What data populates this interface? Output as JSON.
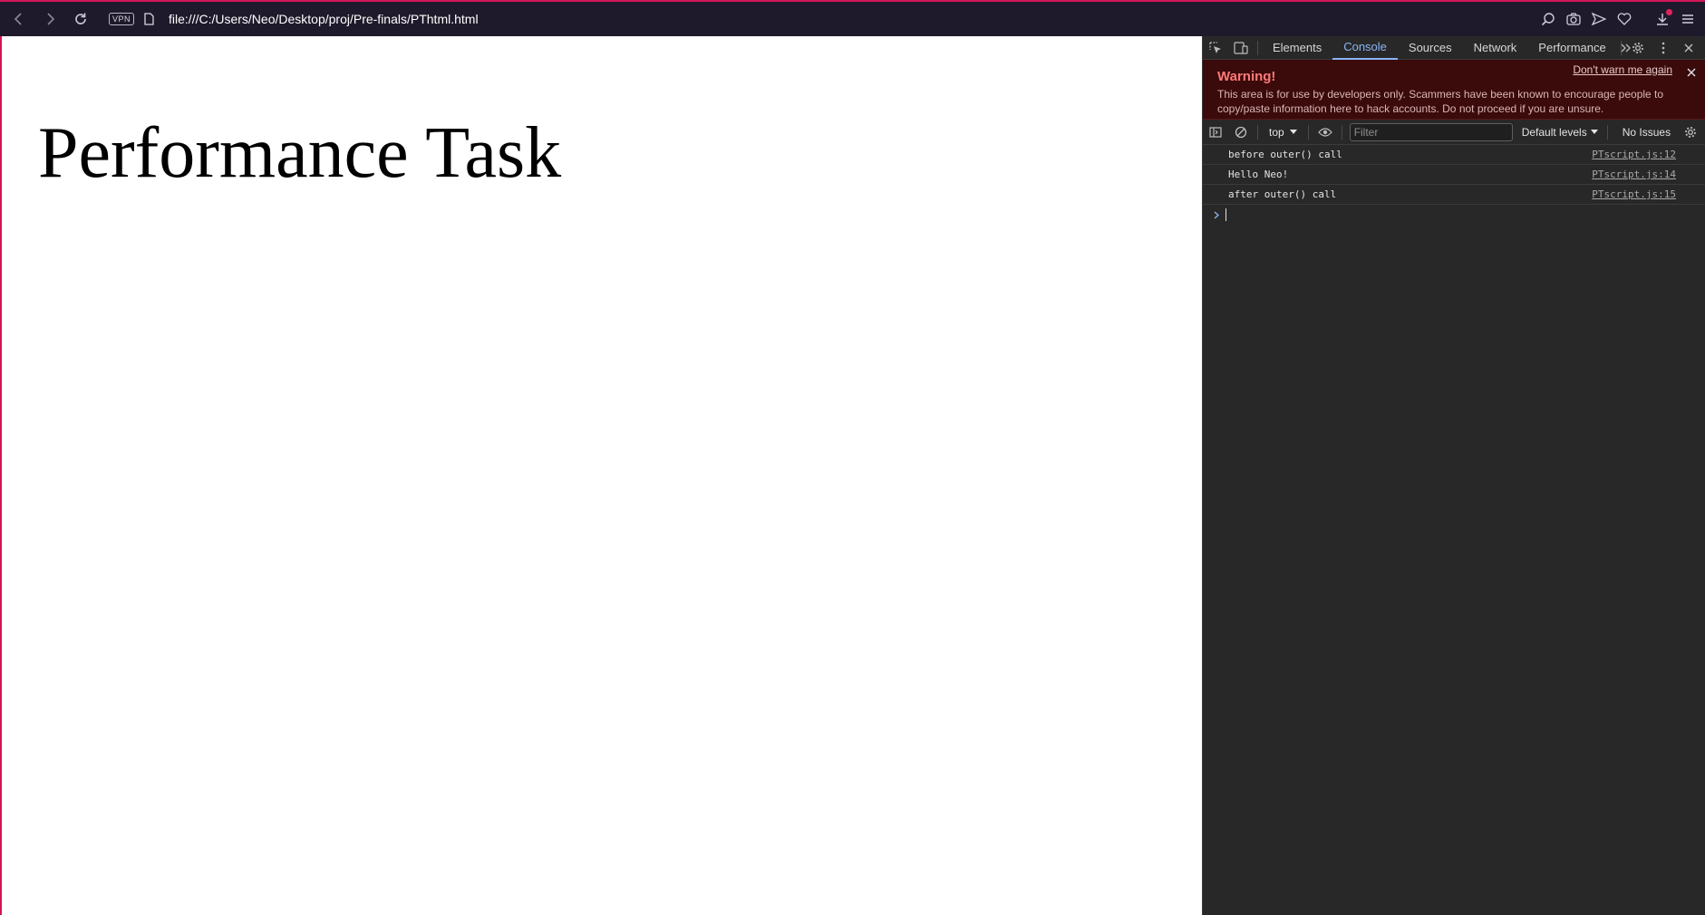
{
  "browser": {
    "address": "file:///C:/Users/Neo/Desktop/proj/Pre-finals/PThtml.html",
    "vpn_label": "VPN",
    "accent_color": "#d4145a"
  },
  "page": {
    "heading": "Performance Task"
  },
  "devtools": {
    "tabs": [
      "Elements",
      "Console",
      "Sources",
      "Network",
      "Performance"
    ],
    "active_tab": "Console",
    "warning": {
      "title": "Warning!",
      "text": "This area is for use by developers only. Scammers have been known to encourage people to copy/paste information here to hack accounts. Do not proceed if you are unsure.",
      "dont_warn": "Don't warn me again"
    },
    "console": {
      "context": "top",
      "filter_placeholder": "Filter",
      "levels": "Default levels",
      "issues": "No Issues",
      "messages": [
        {
          "text": "before outer() call",
          "source": "PTscript.js:12"
        },
        {
          "text": "Hello Neo!",
          "source": "PTscript.js:14"
        },
        {
          "text": "after outer() call",
          "source": "PTscript.js:15"
        }
      ]
    }
  }
}
